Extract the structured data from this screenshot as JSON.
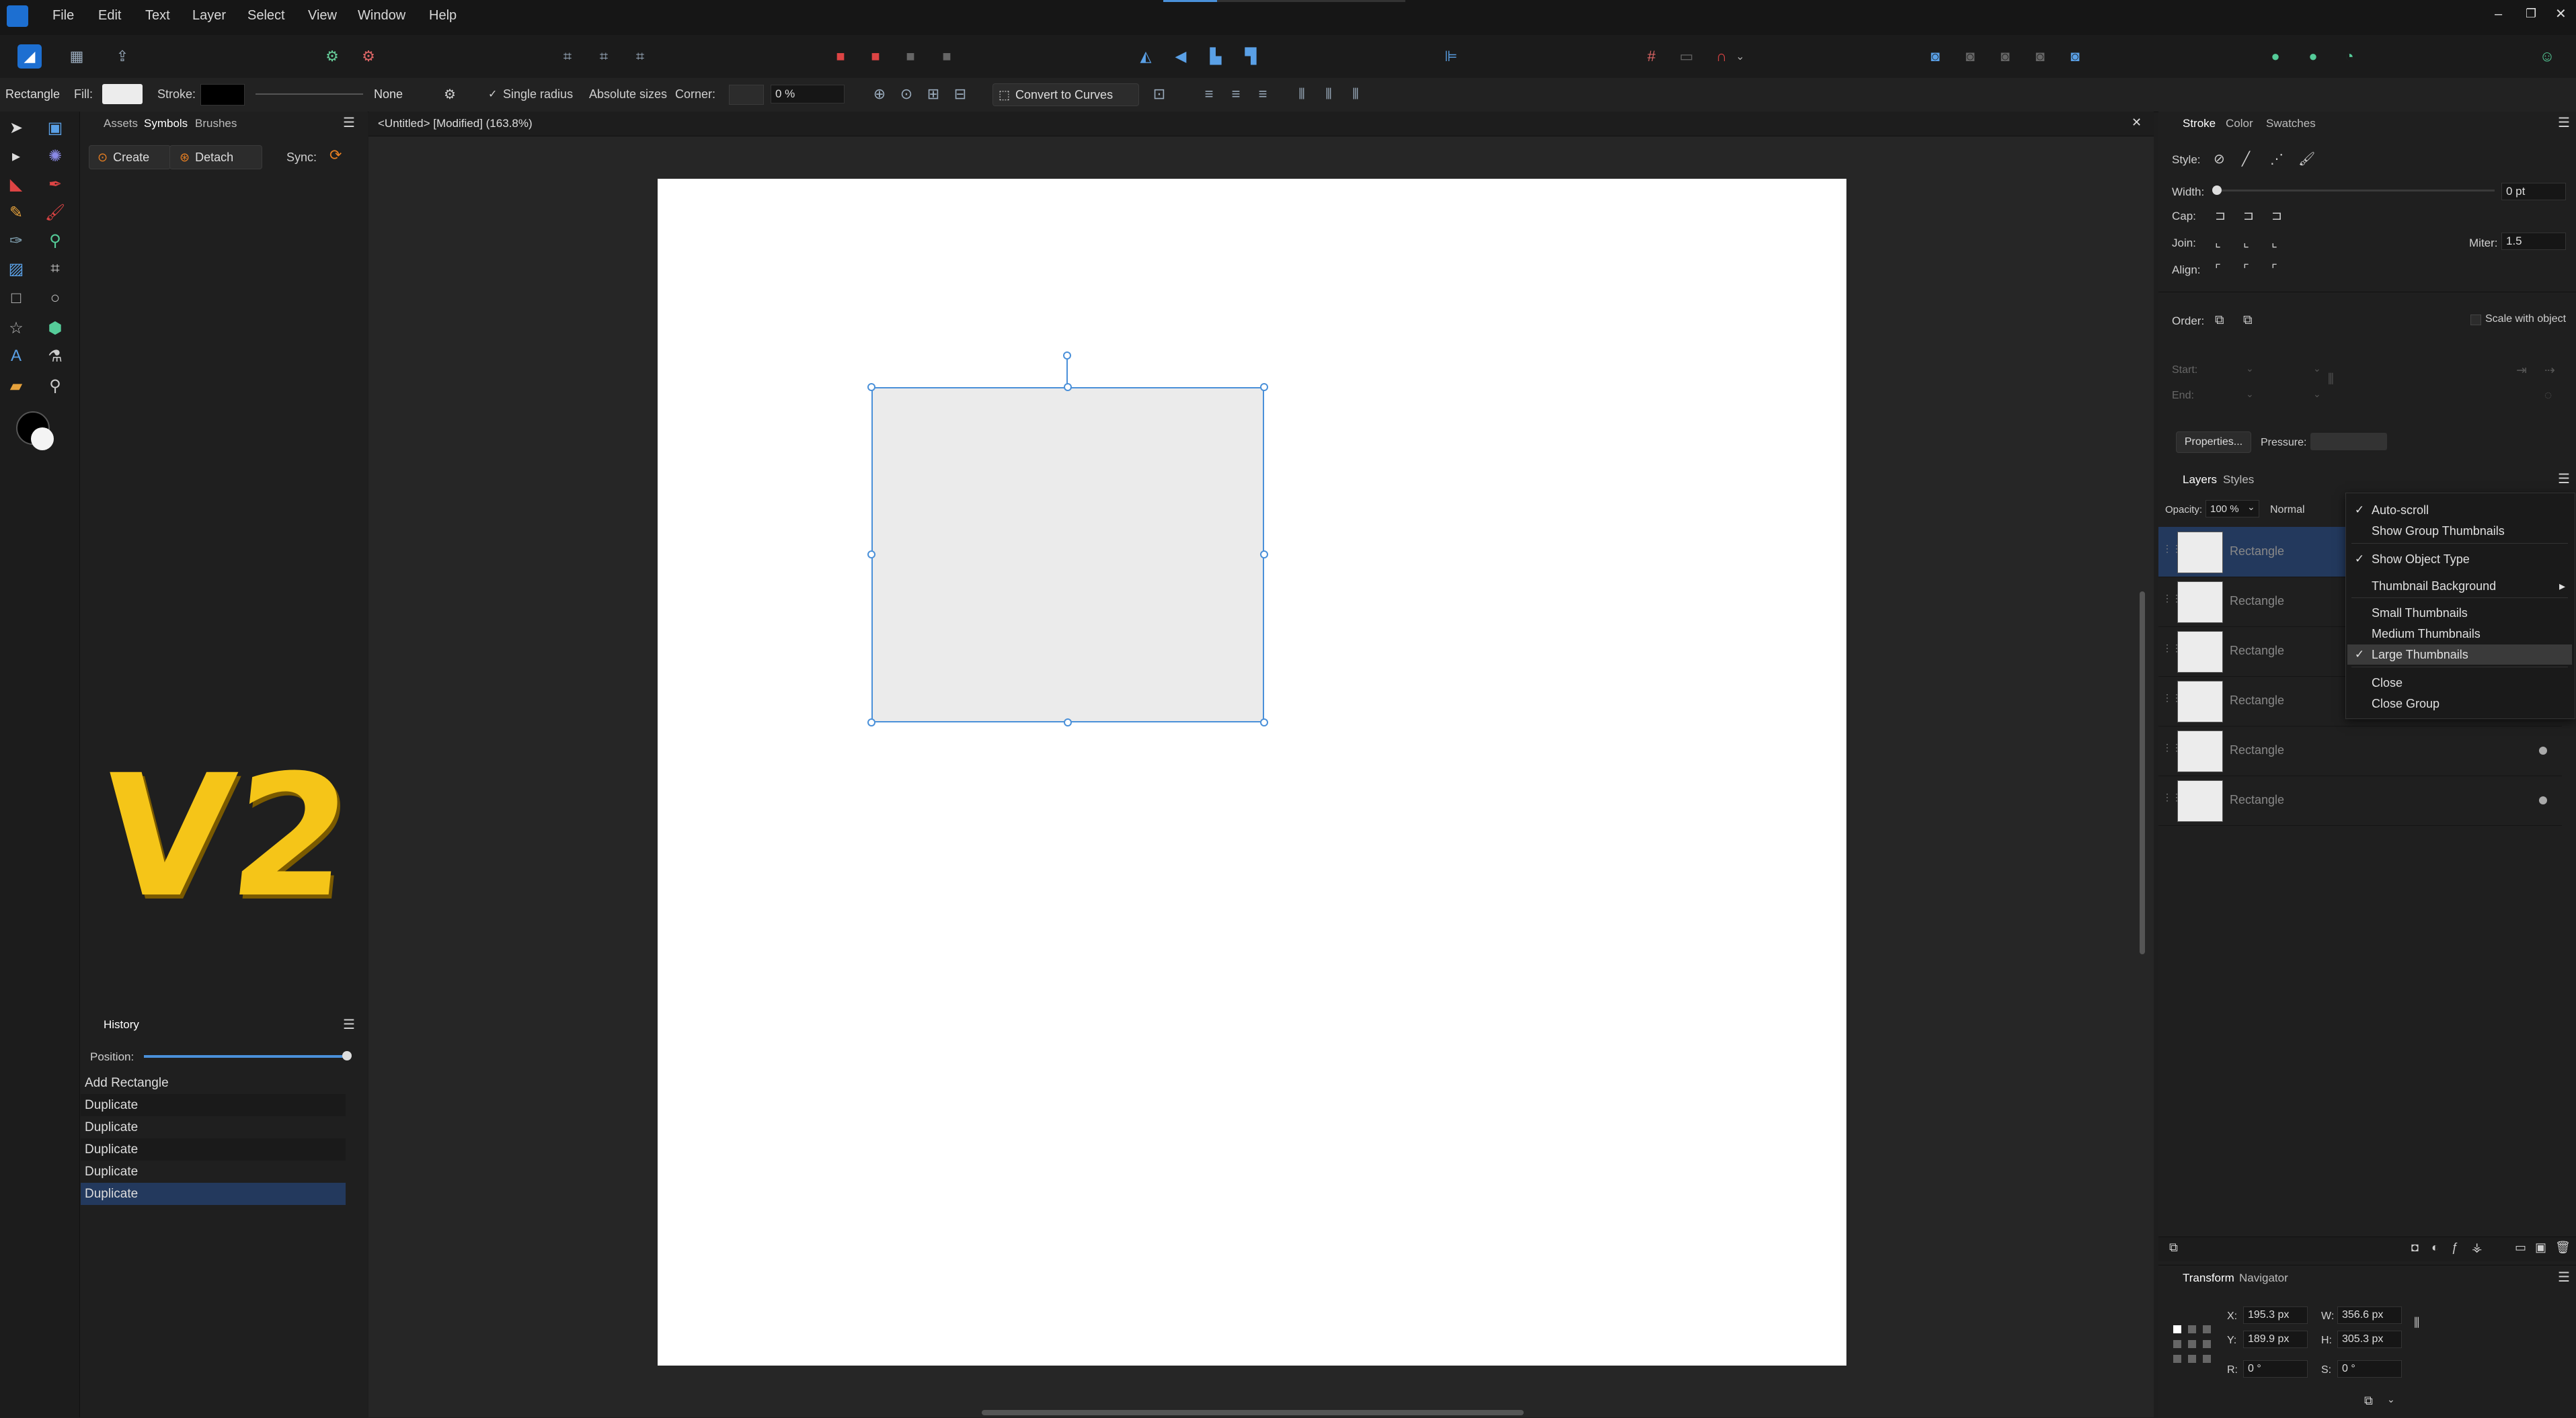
{
  "menubar": {
    "items": [
      "File",
      "Edit",
      "Text",
      "Layer",
      "Select",
      "View",
      "Window",
      "Help"
    ],
    "window_controls": [
      "minimize",
      "restore",
      "close"
    ]
  },
  "context_toolbar": {
    "tool_name": "Rectangle",
    "fill_label": "Fill:",
    "stroke_label": "Stroke:",
    "stroke_style_value": "None",
    "single_radius_label": "Single radius",
    "absolute_sizes_label": "Absolute sizes",
    "corner_label": "Corner:",
    "corner_value": "0 %",
    "convert_to_curves_label": "Convert to Curves"
  },
  "left_panel": {
    "tabs": [
      "Assets",
      "Symbols",
      "Brushes"
    ],
    "create_label": "Create",
    "detach_label": "Detach",
    "sync_label": "Sync:",
    "overlay_text": "V2"
  },
  "history": {
    "title": "History",
    "position_label": "Position:",
    "position_fraction": 1.0,
    "items": [
      "Add Rectangle",
      "Duplicate",
      "Duplicate",
      "Duplicate",
      "Duplicate",
      "Duplicate"
    ],
    "selected_index": 5
  },
  "document": {
    "tab_title": "<Untitled> [Modified] (163.8%)"
  },
  "stroke_panel": {
    "tabs": [
      "Stroke",
      "Color",
      "Swatches"
    ],
    "style_label": "Style:",
    "width_label": "Width:",
    "width_value": "0 pt",
    "cap_label": "Cap:",
    "join_label": "Join:",
    "miter_label": "Miter:",
    "miter_value": "1.5",
    "align_label": "Align:",
    "order_label": "Order:",
    "scale_with_object_label": "Scale with object",
    "start_label": "Start:",
    "end_label": "End:",
    "properties_label": "Properties...",
    "pressure_label": "Pressure:"
  },
  "layers_panel": {
    "tabs": [
      "Layers",
      "Styles"
    ],
    "opacity_label": "Opacity:",
    "opacity_value": "100 %",
    "blend_mode": "Normal",
    "layers": [
      {
        "name": "Rectangle",
        "selected": true,
        "dot": false
      },
      {
        "name": "Rectangle",
        "selected": false,
        "dot": false
      },
      {
        "name": "Rectangle",
        "selected": false,
        "dot": false
      },
      {
        "name": "Rectangle",
        "selected": false,
        "dot": false
      },
      {
        "name": "Rectangle",
        "selected": false,
        "dot": true
      },
      {
        "name": "Rectangle",
        "selected": false,
        "dot": true
      }
    ]
  },
  "layers_menu": {
    "items": [
      {
        "label": "Auto-scroll",
        "checked": true
      },
      {
        "label": "Show Group Thumbnails",
        "checked": false
      },
      {
        "label": "Show Object Type",
        "checked": true
      },
      {
        "label": "Thumbnail Background",
        "checked": false,
        "submenu": true
      },
      {
        "label": "Small Thumbnails",
        "checked": false
      },
      {
        "label": "Medium Thumbnails",
        "checked": false
      },
      {
        "label": "Large Thumbnails",
        "checked": true,
        "highlighted": true
      },
      {
        "label": "Close",
        "checked": false
      },
      {
        "label": "Close Group",
        "checked": false
      }
    ]
  },
  "transform_panel": {
    "tabs": [
      "Transform",
      "Navigator"
    ],
    "x_label": "X:",
    "x_value": "195.3 px",
    "y_label": "Y:",
    "y_value": "189.9 px",
    "w_label": "W:",
    "w_value": "356.6 px",
    "h_label": "H:",
    "h_value": "305.3 px",
    "r_label": "R:",
    "r_value": "0 °",
    "s_label": "S:",
    "s_value": "0 °"
  },
  "colors": {
    "accent": "#4a90d9",
    "selection_row": "#23395d",
    "overlay_yellow": "#f5c518"
  }
}
